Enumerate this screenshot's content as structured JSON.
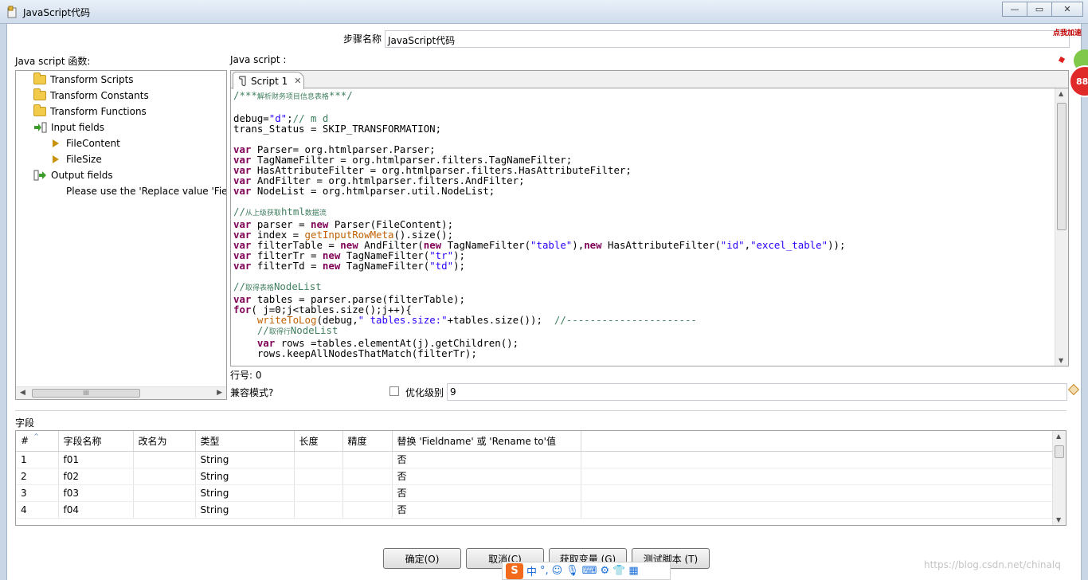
{
  "window": {
    "title": "JavaScript代码",
    "buttons": [
      "minimize",
      "maximize",
      "close"
    ]
  },
  "step": {
    "label": "步骤名称",
    "value": "JavaScript代码"
  },
  "left_panel": {
    "label": "Java script 函数:",
    "tree": [
      {
        "label": "Transform Scripts",
        "icon": "folder-icon",
        "level": 0
      },
      {
        "label": "Transform Constants",
        "icon": "folder-icon",
        "level": 0
      },
      {
        "label": "Transform Functions",
        "icon": "folder-icon",
        "level": 0
      },
      {
        "label": "Input fields",
        "icon": "input-fields-icon",
        "level": 0
      },
      {
        "label": "FileContent",
        "icon": "field-arrow-icon",
        "level": 1
      },
      {
        "label": "FileSize",
        "icon": "field-arrow-icon",
        "level": 1
      },
      {
        "label": "Output fields",
        "icon": "output-fields-icon",
        "level": 0
      },
      {
        "label": "Please use the 'Replace value 'Field",
        "icon": "",
        "level": 1
      }
    ],
    "scroll_grip": "III"
  },
  "editor": {
    "label": "Java script :",
    "tab_label": "Script 1",
    "line_status": "行号: 0"
  },
  "compat": {
    "label": "兼容模式?"
  },
  "optimize": {
    "label": "优化级别",
    "value": "9"
  },
  "fields": {
    "label": "字段",
    "columns": [
      "#",
      "字段名称",
      "改名为",
      "类型",
      "长度",
      "精度",
      "替换 'Fieldname' 或 'Rename to'值"
    ],
    "rows": [
      [
        "1",
        "f01",
        "",
        "String",
        "",
        "",
        "否"
      ],
      [
        "2",
        "f02",
        "",
        "String",
        "",
        "",
        "否"
      ],
      [
        "3",
        "f03",
        "",
        "String",
        "",
        "",
        "否"
      ],
      [
        "4",
        "f04",
        "",
        "String",
        "",
        "",
        "否"
      ]
    ]
  },
  "buttons": {
    "ok": "确定(O)",
    "cancel": "取消(C)",
    "get_vars": "获取变量 (G)",
    "test": "测试脚本 (T)"
  },
  "overlay": {
    "ime_chars": [
      "中",
      "°,"
    ],
    "watermark": "https://blog.csdn.net/chinalq",
    "speed_label": "点我加速",
    "speed_value": "88"
  },
  "colors": {
    "keyword": "#7f0055",
    "string": "#2a00ff",
    "comment": "#3f7f5f",
    "function": "#c06000"
  }
}
